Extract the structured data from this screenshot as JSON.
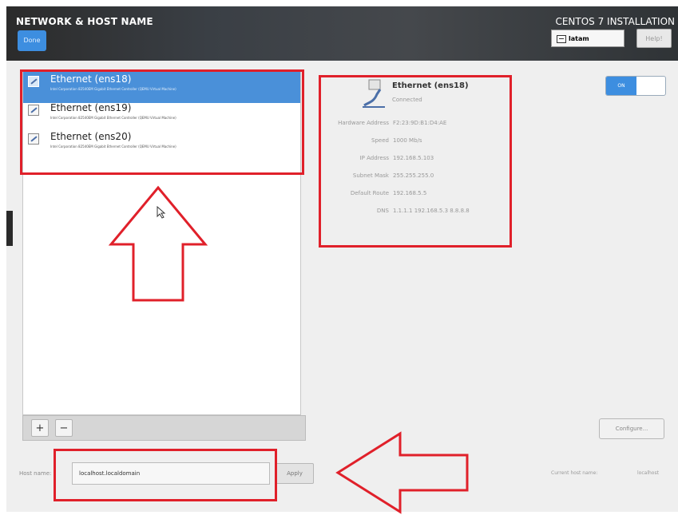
{
  "header": {
    "title": "NETWORK & HOST NAME",
    "done_label": "Done",
    "product_title": "CENTOS 7 INSTALLATION",
    "keyboard_layout": "latam",
    "help_label": "Help!"
  },
  "interfaces": [
    {
      "name": "Ethernet (ens18)",
      "description": "Intel Corporation 82540EM Gigabit Ethernet Controller (QEMU Virtual Machine)",
      "selected": true
    },
    {
      "name": "Ethernet (ens19)",
      "description": "Intel Corporation 82540EM Gigabit Ethernet Controller (QEMU Virtual Machine)",
      "selected": false
    },
    {
      "name": "Ethernet (ens20)",
      "description": "Intel Corporation 82540EM Gigabit Ethernet Controller (QEMU Virtual Machine)",
      "selected": false
    }
  ],
  "list_toolbar": {
    "add_label": "+",
    "remove_label": "−"
  },
  "details": {
    "name": "Ethernet (ens18)",
    "status": "Connected",
    "hardware_address_label": "Hardware Address",
    "hardware_address": "F2:23:9D:B1:D4:AE",
    "speed_label": "Speed",
    "speed": "1000 Mb/s",
    "ip_address_label": "IP Address",
    "ip_address": "192.168.5.103",
    "subnet_mask_label": "Subnet Mask",
    "subnet_mask": "255.255.255.0",
    "default_route_label": "Default Route",
    "default_route": "192.168.5.5",
    "dns_label": "DNS",
    "dns": "1.1.1.1 192.168.5.3 8.8.8.8"
  },
  "toggle": {
    "on_label": "ON",
    "state": "on"
  },
  "configure_label": "Configure...",
  "hostname": {
    "label": "Host name:",
    "value": "localhost.localdomain",
    "apply_label": "Apply",
    "current_label": "Current host name:",
    "current_value": "localhost"
  },
  "colors": {
    "header_dark": "#3a3f45",
    "accent_blue": "#3d8ee0",
    "selection_blue": "#4a90d9",
    "annotation_red": "#e0202a"
  }
}
